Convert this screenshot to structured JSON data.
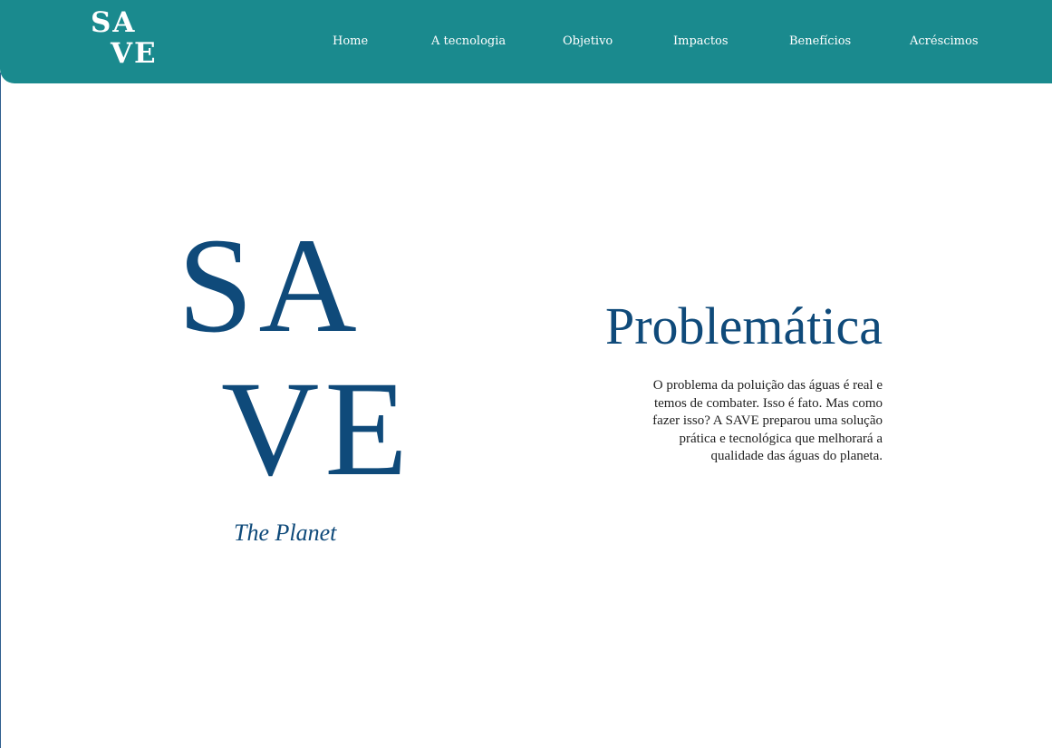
{
  "header": {
    "logo": {
      "line1": "SA",
      "line2": "VE"
    },
    "nav": [
      {
        "label": "Home"
      },
      {
        "label": "A tecnologia"
      },
      {
        "label": "Objetivo"
      },
      {
        "label": "Impactos"
      },
      {
        "label": "Benefícios"
      },
      {
        "label": "Acréscimos"
      }
    ]
  },
  "hero": {
    "line1": "SA",
    "line2": "VE",
    "tagline": "The Planet"
  },
  "problem": {
    "title": "Problemática",
    "body": "O problema da poluição das águas é real e temos de combater. Isso é fato. Mas como fazer isso? A SAVE preparou uma solução prática e tecnológica que melhorará a qualidade das águas do planeta."
  },
  "colors": {
    "navbar": "#1a8a8e",
    "brand_blue": "#0f4a7a",
    "text": "#1e1e1e",
    "background": "#ffffff"
  }
}
